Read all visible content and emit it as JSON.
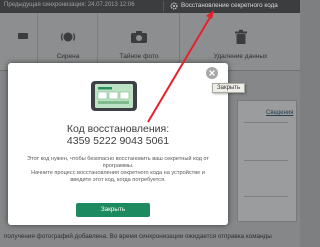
{
  "topbar": {
    "sync_text": "Предыдущая синхронизация: 24.07.2013 12:06",
    "restore_code_link": "Восстановление секретного кода"
  },
  "toolbar": {
    "items": [
      {
        "label": "",
        "icon": "bar-icon"
      },
      {
        "label": "Сирена",
        "icon": "siren-icon"
      },
      {
        "label": "Тайное фото",
        "icon": "camera-icon"
      },
      {
        "label": "Удаление данных",
        "icon": "trash-icon"
      }
    ]
  },
  "right_panel": {
    "link": "Сведения"
  },
  "bottom_text": "получения фотографий добавлена. Во время синхронизации ожидается отправка команды",
  "modal": {
    "title": "Код восстановления:",
    "code": "4359 5222 9043 5061",
    "desc_lines": [
      "Этот код нужен, чтобы безопасно восстановить ваш секретный код от",
      "программы.",
      "Начните процесс восстановления секретного кода на устройстве и",
      "введите этот код, когда потребуется."
    ],
    "close_button": "Закрыть",
    "close_tooltip": "Закрыть"
  },
  "colors": {
    "accent_button": "#1e8a60",
    "annotation_arrow": "#e8202a",
    "overlay": "#7d7f80"
  }
}
